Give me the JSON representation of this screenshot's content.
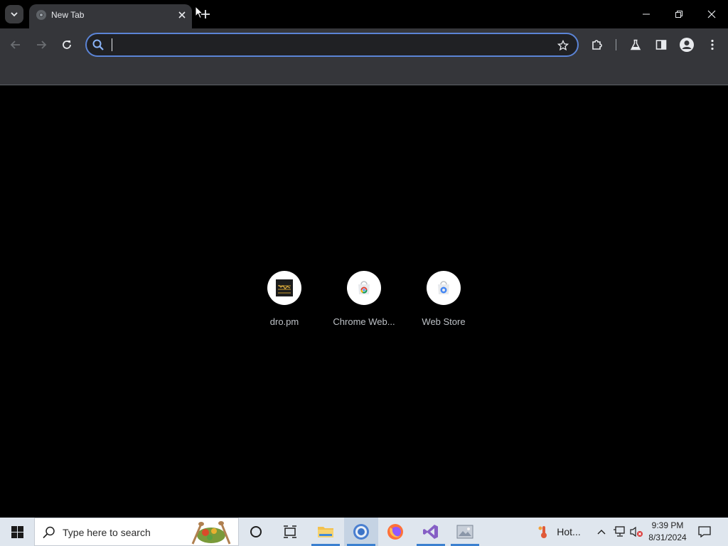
{
  "tabstrip": {
    "active_tab_title": "New Tab"
  },
  "omnibox": {
    "value": "",
    "placeholder": ""
  },
  "shortcuts": [
    {
      "label": "dro.pm",
      "icon": "dro-pm-favicon"
    },
    {
      "label": "Chrome Web...",
      "icon": "chrome-web-store-icon"
    },
    {
      "label": "Web Store",
      "icon": "web-store-icon"
    }
  ],
  "taskbar": {
    "search_placeholder": "Type here to search",
    "weather_text": "Hot...",
    "clock_time": "9:39 PM",
    "clock_date": "8/31/2024"
  },
  "colors": {
    "accent": "#5b84d6",
    "toolbar": "#35363a",
    "taskbar": "#dfe6ee"
  }
}
